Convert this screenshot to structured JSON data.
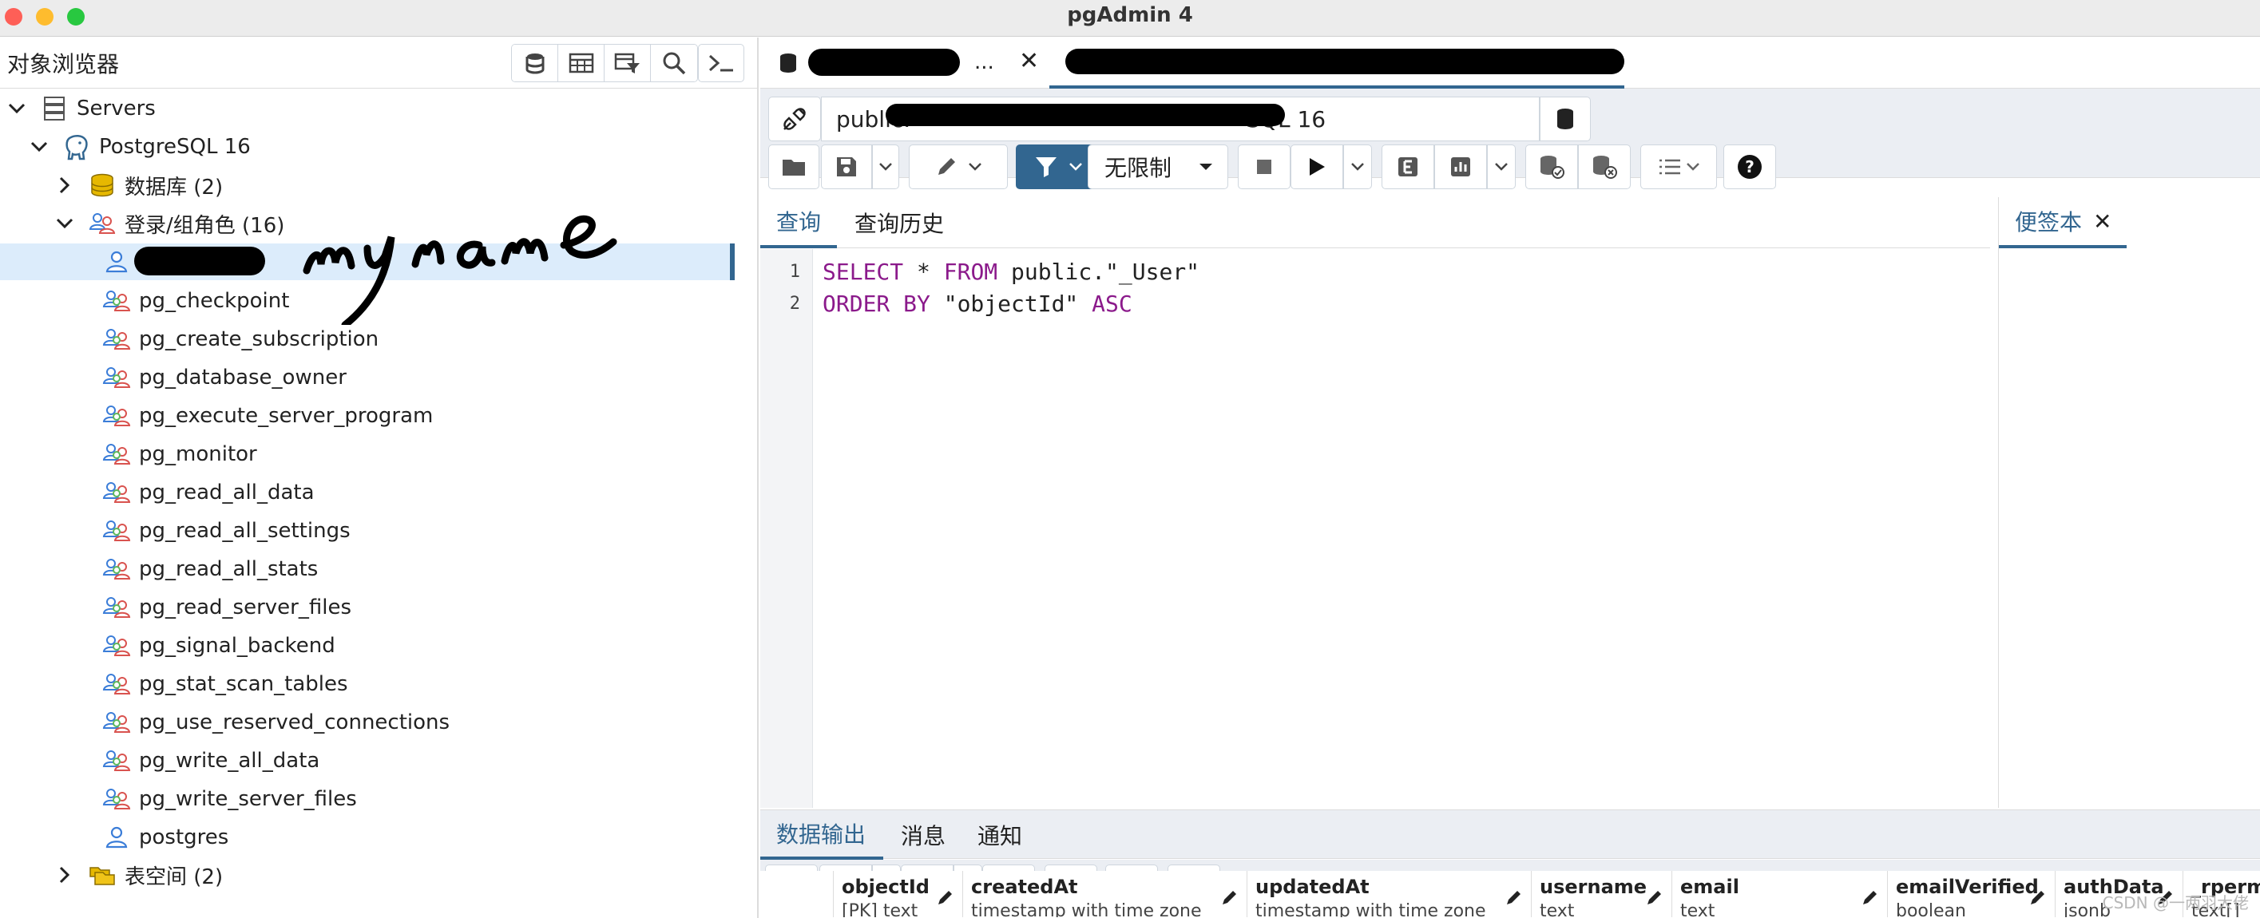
{
  "window": {
    "title": "pgAdmin 4"
  },
  "browser": {
    "title": "对象浏览器",
    "toolbar_icons": [
      "database-icon",
      "table-icon",
      "filter-table-icon",
      "search-icon",
      "terminal-icon"
    ],
    "tree": {
      "servers": "Servers",
      "server": "PostgreSQL 16",
      "databases": "数据库 (2)",
      "login_roles": "登录/组角色 (16)",
      "roles": [
        "pg_checkpoint",
        "pg_create_subscription",
        "pg_database_owner",
        "pg_execute_server_program",
        "pg_monitor",
        "pg_read_all_data",
        "pg_read_all_settings",
        "pg_read_all_stats",
        "pg_read_server_files",
        "pg_signal_backend",
        "pg_stat_scan_tables",
        "pg_use_reserved_connections",
        "pg_write_all_data",
        "pg_write_server_files",
        "postgres"
      ],
      "tablespaces": "表空间 (2)"
    },
    "annotation": "my name"
  },
  "query_tool": {
    "tab1_suffix": "...",
    "connection_prefix": "public.",
    "connection_suffix": "SQL 16",
    "limit_label": "无限制",
    "tabs": {
      "query": "查询",
      "history": "查询历史"
    },
    "notes_tab": "便签本",
    "code_lines": [
      {
        "n": "1",
        "kw1": "SELECT",
        "mid": " * ",
        "kw2": "FROM",
        "rest": " public.\"_User\""
      },
      {
        "n": "2",
        "kw1": "ORDER BY",
        "mid": " \"objectId\" ",
        "kw2": "ASC",
        "rest": ""
      }
    ],
    "output_tabs": {
      "data": "数据输出",
      "messages": "消息",
      "notifications": "通知"
    },
    "columns": [
      {
        "name": "objectId",
        "type": "[PK] text"
      },
      {
        "name": "createdAt",
        "type": "timestamp with time zone"
      },
      {
        "name": "updatedAt",
        "type": "timestamp with time zone"
      },
      {
        "name": "username",
        "type": "text"
      },
      {
        "name": "email",
        "type": "text"
      },
      {
        "name": "emailVerified",
        "type": "boolean"
      },
      {
        "name": "authData",
        "type": "jsonb"
      },
      {
        "name": "_rperm",
        "type": "text[]"
      }
    ]
  },
  "watermark": "CSDN @一两羽大佬",
  "colors": {
    "accent": "#326690",
    "keyword": "#8b1a8b",
    "selected_row": "#dcecfb"
  }
}
